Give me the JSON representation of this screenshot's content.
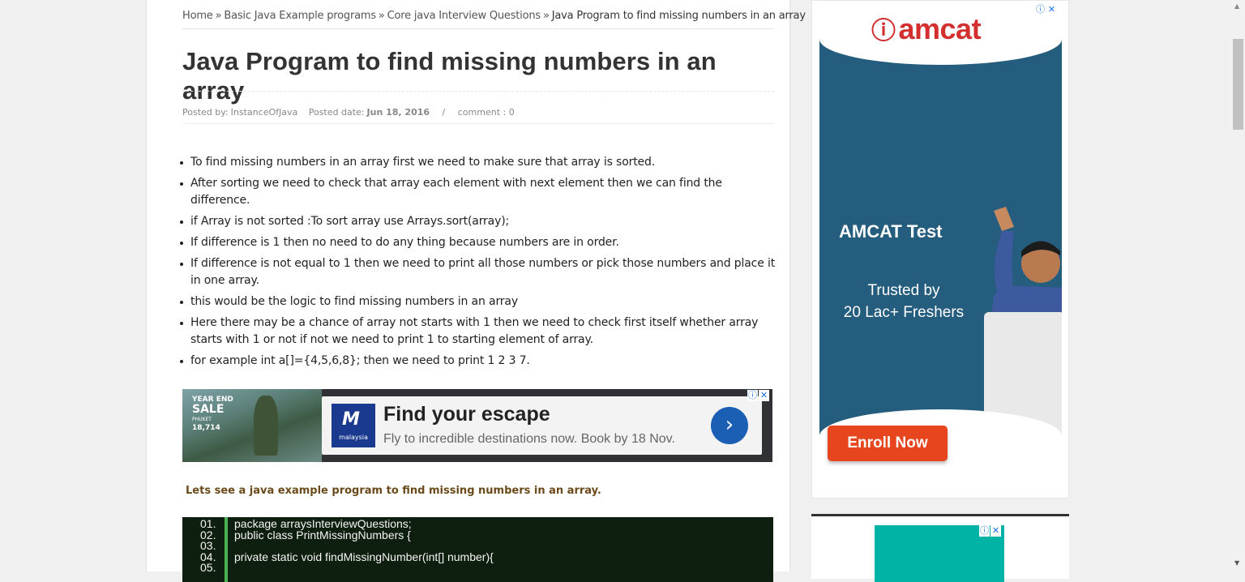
{
  "breadcrumb": {
    "items": [
      "Home",
      "Basic Java Example programs",
      "Core java Interview Questions"
    ],
    "separator": "»",
    "current": "Java Program to find missing numbers in an array"
  },
  "post": {
    "title": "Java Program to find missing numbers in an array",
    "meta": {
      "posted_by_label": "Posted by:",
      "author": "InstanceOfJava",
      "posted_date_label": "Posted date:",
      "date": "Jun 18, 2016",
      "divider": "/",
      "comments": "comment : 0"
    },
    "bullets": [
      "To find missing numbers in an array first we need to make sure that array is sorted.",
      "After sorting we need to check that array each element with next element then we can find the difference.",
      "if Array is not sorted :To sort array use Arrays.sort(array);",
      "If difference is 1 then no need to do any thing because numbers are in order.",
      "If difference is not equal to 1 then we need to print all those numbers or pick those numbers and place it in one array.",
      "this would be the logic to find missing numbers in an array",
      "Here there may be a chance of array not starts with 1 then we need to check first itself whether array starts with 1 or not if not we need to print 1 to starting element of array.",
      "for example int a[]={4,5,6,8}; then we need to print 1 2 3  7."
    ],
    "lead": "Lets see a java example program to find missing numbers in an array.",
    "code_lines": [
      {
        "num": "01.",
        "text": "package arraysInterviewQuestions;"
      },
      {
        "num": "02.",
        "text": "public class PrintMissingNumbers {"
      },
      {
        "num": "03.",
        "text": ""
      },
      {
        "num": "04.",
        "text": "private static void findMissingNumber(int[] number){"
      },
      {
        "num": "05.",
        "text": ""
      }
    ]
  },
  "banner_ad": {
    "sale_line1": "YEAR END",
    "sale_line2": "SALE",
    "sale_line3": "PHUKET",
    "sale_price": "18,714",
    "logo_text": "malaysia",
    "headline": "Find your escape",
    "subline": "Fly to incredible destinations now. Book by 18 Nov.",
    "go_icon": "›",
    "info_icon": "ⓘ",
    "close_icon": "✕"
  },
  "side_ad": {
    "brand": "amcat",
    "test": "AMCAT Test",
    "trusted_line1": "Trusted by",
    "trusted_line2": "20 Lac+ Freshers",
    "cta": "Enroll Now",
    "info_icon": "ⓘ",
    "close_icon": "✕"
  },
  "side_widget": {
    "info_icon": "ⓘ",
    "close_icon": "✕"
  },
  "scrollbar": {
    "up_icon": "▲",
    "down_icon": "▼"
  },
  "colors": {
    "title": "#333333",
    "lead": "#6b4a1a",
    "code_bg": "#0f1f0f",
    "code_bar": "#4caf50",
    "side_ad_bg": "#245d7e",
    "enroll": "#e6451d"
  }
}
